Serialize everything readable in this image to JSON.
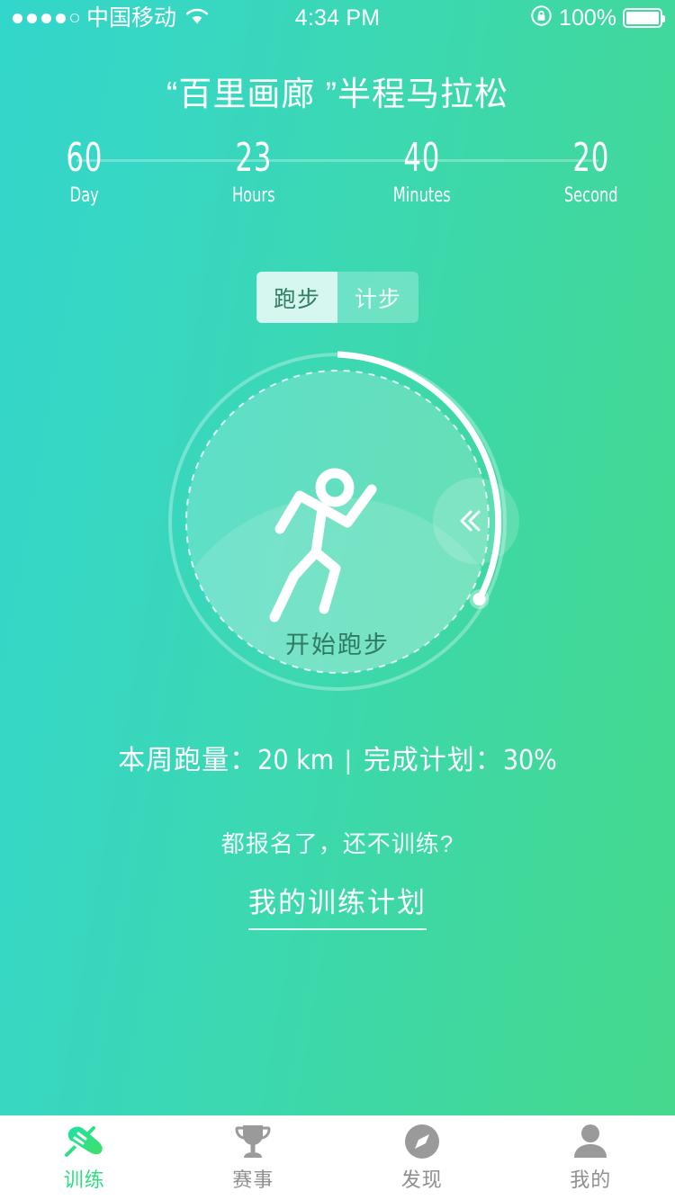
{
  "status_bar": {
    "carrier": "中国移动",
    "signal_dots_filled": 4,
    "signal_dots_total": 5,
    "wifi_icon": "wifi-icon",
    "time": "4:34 PM",
    "lock_icon": "rotation-lock-icon",
    "battery_percent": "100%",
    "battery_level": 100
  },
  "header": {
    "title": "“百里画廊 ”半程马拉松"
  },
  "countdown": {
    "units": [
      {
        "value": "60",
        "label": "Day"
      },
      {
        "value": "23",
        "label": "Hours"
      },
      {
        "value": "40",
        "label": "Minutes"
      },
      {
        "value": "20",
        "label": "Second"
      }
    ]
  },
  "segment": {
    "options": [
      {
        "label": "跑步",
        "active": true
      },
      {
        "label": "计步",
        "active": false
      }
    ]
  },
  "dial": {
    "icon": "running-person-icon",
    "start_label": "开始跑步",
    "handle_icon": "double-chevron-left-icon",
    "progress_percent": 30
  },
  "stats": {
    "weekly_distance_label": "本周跑量：",
    "weekly_distance_value": "20 km",
    "separator": "|",
    "plan_label": "完成计划：",
    "plan_value": "30%"
  },
  "promo": {
    "text": "都报名了，还不训练?",
    "link": "我的训练计划"
  },
  "tabbar": {
    "items": [
      {
        "label": "训练",
        "icon": "running-shoe-icon",
        "active": true
      },
      {
        "label": "赛事",
        "icon": "trophy-icon",
        "active": false
      },
      {
        "label": "发现",
        "icon": "compass-icon",
        "active": false
      },
      {
        "label": "我的",
        "icon": "person-icon",
        "active": false
      }
    ]
  },
  "colors": {
    "gradient_start": "#33d6cb",
    "gradient_end": "#45d98a",
    "accent": "#2fdd83",
    "tab_inactive": "#8f8f8f",
    "dial_text": "#2e7a63"
  }
}
